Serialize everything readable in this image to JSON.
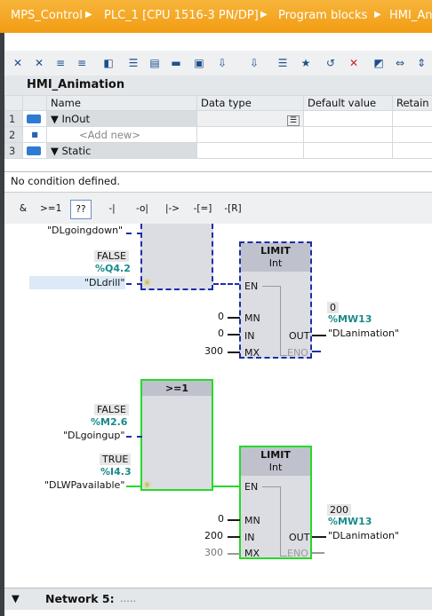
{
  "breadcrumb": [
    "MPS_Control",
    "PLC_1 [CPU 1516-3 PN/DP]",
    "Program blocks",
    "HMI_An"
  ],
  "block": {
    "title": "HMI_Animation"
  },
  "interface": {
    "headers": [
      "Name",
      "Data type",
      "Default value",
      "Retain"
    ],
    "rows": [
      {
        "num": "1",
        "name": "InOut",
        "type": "",
        "default": "",
        "retain": ""
      },
      {
        "num": "2",
        "name": "<Add new>",
        "type": "",
        "default": "",
        "retain": ""
      },
      {
        "num": "3",
        "name": "Static",
        "type": "",
        "default": "",
        "retain": ""
      }
    ]
  },
  "condition_text": "No condition defined.",
  "ladder_toolbar": [
    "&",
    ">=1",
    "??",
    "-|",
    "-o|",
    "|->",
    "-[=]",
    "-[R]"
  ],
  "network1": {
    "in_tag_top": "\"DLgoingdown\"",
    "false_val": "FALSE",
    "q_addr": "%Q4.2",
    "drill_tag": "\"DLdrill\"",
    "limit": {
      "title": "LIMIT",
      "type": "Int",
      "pins": {
        "en": "EN",
        "mn": "MN",
        "in": "IN",
        "mx": "MX",
        "out": "OUT",
        "eno": "ENO"
      },
      "mn_val": "0",
      "in_val": "0",
      "mx_val": "300"
    },
    "out_val": "0",
    "out_addr": "%MW13",
    "out_tag": "\"DLanimation\""
  },
  "network2": {
    "or_title": ">=1",
    "false_val": "FALSE",
    "m_addr": "%M2.6",
    "up_tag": "\"DLgoingup\"",
    "true_val": "TRUE",
    "i_addr": "%I4.3",
    "avail_tag": "\"DLWPavailable\"",
    "limit": {
      "title": "LIMIT",
      "type": "Int",
      "pins": {
        "en": "EN",
        "mn": "MN",
        "in": "IN",
        "mx": "MX",
        "out": "OUT",
        "eno": "ENO"
      },
      "mn_val": "0",
      "in_val": "200",
      "mx_val": "300"
    },
    "out_val": "200",
    "out_addr": "%MW13",
    "out_tag": "\"DLanimation\""
  },
  "footer": {
    "title": "Network 5:",
    "comment": "....."
  }
}
